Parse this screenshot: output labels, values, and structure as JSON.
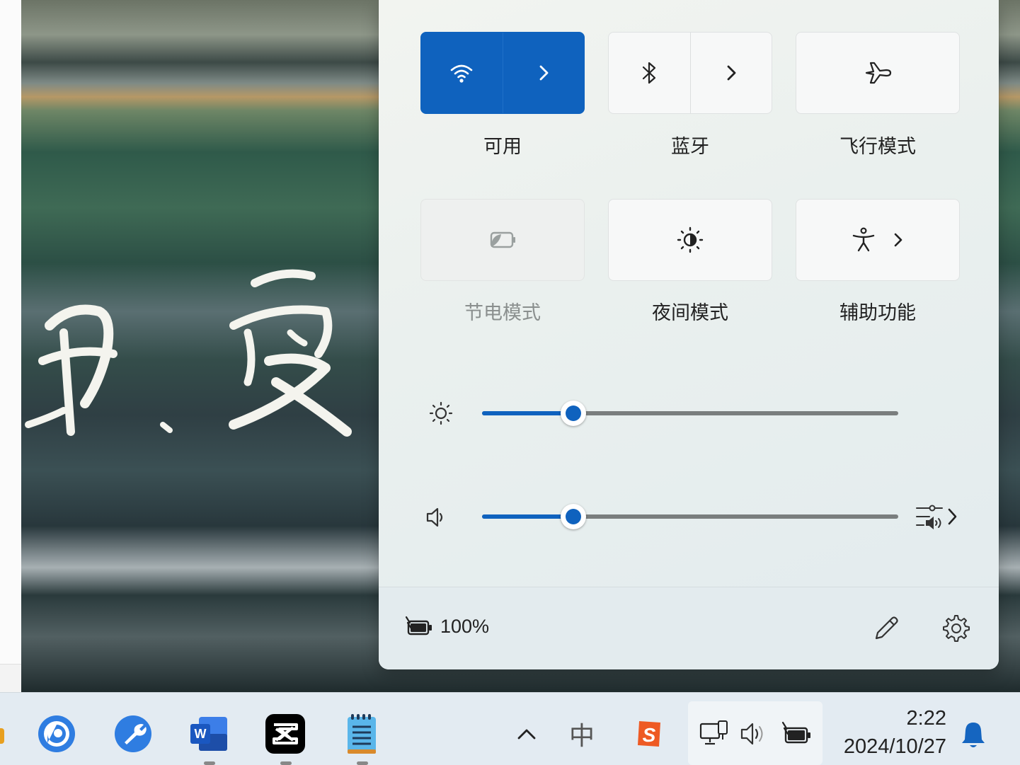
{
  "colors": {
    "accent": "#0f62be",
    "slider_track": "#7a7e7e",
    "tile_bg": "#f7f8f8"
  },
  "panel": {
    "tiles": [
      {
        "label": "可用",
        "icon": "wifi-icon",
        "state": "on",
        "has_chevron": true
      },
      {
        "label": "蓝牙",
        "icon": "bluetooth-icon",
        "state": "off",
        "has_chevron": true
      },
      {
        "label": "飞行模式",
        "icon": "airplane-icon",
        "state": "off",
        "has_chevron": false
      },
      {
        "label": "节电模式",
        "icon": "battery-saver-icon",
        "state": "disabled",
        "has_chevron": false
      },
      {
        "label": "夜间模式",
        "icon": "night-light-icon",
        "state": "off",
        "has_chevron": false
      },
      {
        "label": "辅助功能",
        "icon": "accessibility-icon",
        "state": "off",
        "has_chevron": true
      }
    ],
    "brightness": {
      "icon": "brightness-icon",
      "level": 0.22
    },
    "volume": {
      "icon": "speaker-icon",
      "level": 0.22,
      "extra_icon": "audio-output-icon"
    },
    "footer": {
      "battery_text": "100%",
      "battery_icon": "battery-charging-icon",
      "edit_icon": "pencil-icon",
      "settings_icon": "gear-icon"
    }
  },
  "taskbar": {
    "apps": [
      "chat-app-icon",
      "tools-app-icon",
      "word-app-icon",
      "capcut-app-icon",
      "notepad-app-icon"
    ],
    "tray": {
      "overflow_icon": "chevron-up-icon",
      "ime_label": "中",
      "ime_app_icon": "sogou-icon",
      "network_icon": "network-icon",
      "volume_icon": "speaker-icon",
      "battery_icon": "battery-charging-icon"
    },
    "clock": {
      "time": "2:22",
      "date": "2024/10/27"
    },
    "notification_icon": "bell-icon"
  }
}
